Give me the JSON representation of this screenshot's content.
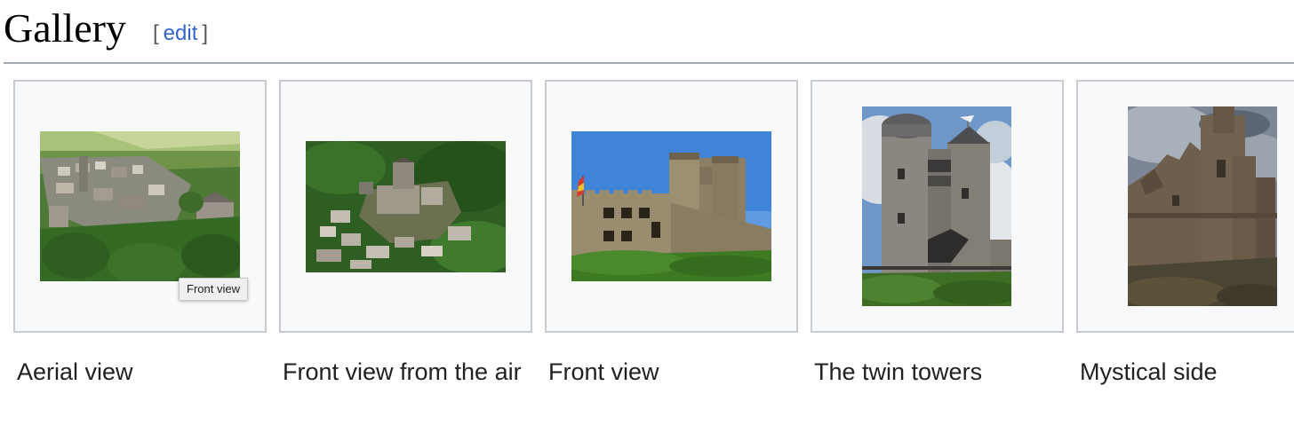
{
  "section": {
    "title": "Gallery",
    "edit_open": "[",
    "edit_label": "edit",
    "edit_close": "]"
  },
  "gallery": {
    "items": [
      {
        "caption": "Aerial view",
        "image": "aerial-view-photo"
      },
      {
        "caption": "Front view from the air",
        "image": "front-view-from-air-photo"
      },
      {
        "caption": "Front view",
        "image": "front-view-photo"
      },
      {
        "caption": "The twin towers",
        "image": "twin-towers-photo"
      },
      {
        "caption": "Mystical side",
        "image": "mystical-side-photo"
      }
    ]
  },
  "tooltip": {
    "text": "Front view"
  },
  "colors": {
    "link": "#3366cc",
    "frame_border": "#c8ccd1",
    "frame_bg": "#f8f9fa",
    "heading_rule": "#a2a9b1"
  }
}
